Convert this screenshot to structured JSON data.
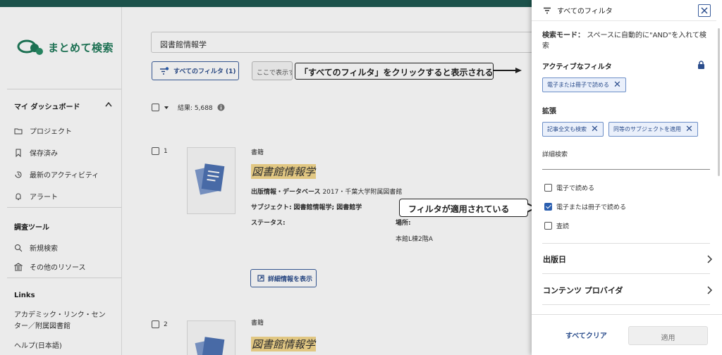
{
  "brand": {
    "logo_text": "まとめて検索"
  },
  "sidebar": {
    "dashboard_heading": "マイ ダッシュボード",
    "dashboard_items": [
      {
        "label": "プロジェクト",
        "icon": "folder-icon"
      },
      {
        "label": "保存済み",
        "icon": "bookmark-icon"
      },
      {
        "label": "最新のアクティビティ",
        "icon": "history-icon"
      },
      {
        "label": "アラート",
        "icon": "bell-icon"
      }
    ],
    "tools_heading": "調査ツール",
    "tools_items": [
      {
        "label": "新規検索",
        "icon": "search-icon"
      },
      {
        "label": "その他のリソース",
        "icon": "library-icon"
      }
    ],
    "links_heading": "Links",
    "links_items": [
      {
        "label": "アカデミック・リンク・センター／附属図書館"
      },
      {
        "label": "ヘルプ(日本語)"
      }
    ]
  },
  "search": {
    "query": "図書館情報学"
  },
  "toolbar": {
    "all_filters_label": "すべてのフィルタ (1)",
    "second_button_label": "ここで表示する"
  },
  "annotations": {
    "top_callout": "「すべてのフィルタ」をクリックすると表示される",
    "filter_callout": "フィルタが適用されている"
  },
  "results": {
    "count_label": "結果: 5,688",
    "items": [
      {
        "index": "1",
        "type": "書籍",
        "title": "図書館情報学",
        "publication_label": "出版情報・データベース",
        "publication_value": "2017・千葉大学附属図書館",
        "subject_label": "サブジェクト:",
        "subject_value": "図書館情報学; 図書館学",
        "status_label": "ステータス:",
        "location_label": "場所:",
        "location_value": "本館L棟2階A",
        "detail_button": "詳細情報を表示"
      },
      {
        "index": "2",
        "type": "書籍",
        "title": "図書館情報学"
      }
    ]
  },
  "filter_panel": {
    "title": "すべてのフィルタ",
    "search_mode_label": "検索モード：",
    "search_mode_value": "スペースに自動的に\"AND\"を入れて検索",
    "active_filters_heading": "アクティブなフィルタ",
    "active_filters": [
      "電子または冊子で読める"
    ],
    "expand_heading": "拡張",
    "expand_chips": [
      "記事全文も検索",
      "同等のサブジェクトを適用"
    ],
    "advanced_heading": "詳細検索",
    "options": [
      {
        "label": "電子で読める",
        "checked": false
      },
      {
        "label": "電子または冊子で読める",
        "checked": true
      },
      {
        "label": "査読",
        "checked": false
      }
    ],
    "sections": [
      "出版日",
      "コンテンツ プロバイダ"
    ],
    "clear_all": "すべてクリア",
    "apply": "適用"
  },
  "colors": {
    "accent": "#2b4d8c",
    "brand_green": "#1f7a5a",
    "title_highlight": "#f5d88e",
    "topbar": "#1f5a52"
  }
}
